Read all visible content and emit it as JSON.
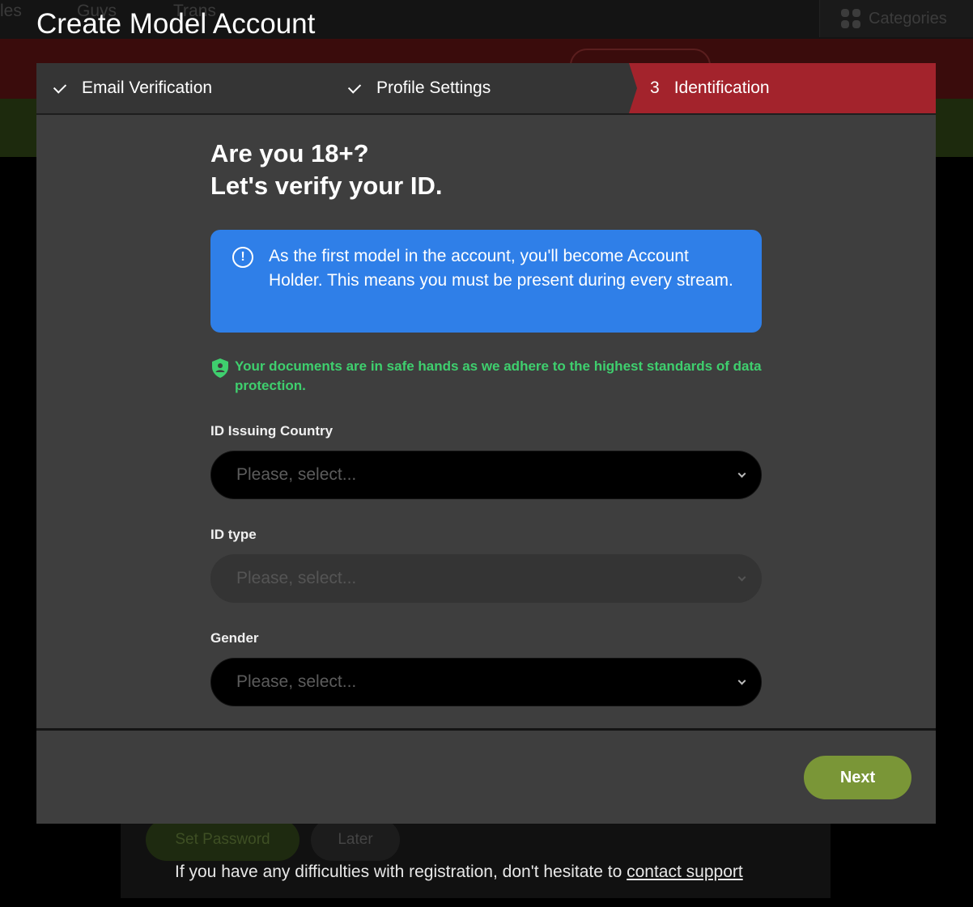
{
  "background": {
    "nav": [
      "les",
      "Guys",
      "Trans"
    ],
    "categories_label": "Categories",
    "page_title": "Create Model Account",
    "set_password_label": "Set Password",
    "later_label": "Later",
    "help_text": "If you have any difficulties with registration, don't hesitate to ",
    "help_link": "contact support"
  },
  "steps": [
    {
      "label": "Email Verification",
      "status": "done"
    },
    {
      "label": "Profile Settings",
      "status": "done"
    },
    {
      "number": "3",
      "label": "Identification",
      "status": "active"
    }
  ],
  "heading": {
    "line1": "Are you 18+?",
    "line2": "Let's verify your ID."
  },
  "info": "As the first model in the account, you'll become Account Holder. This means you must be present during every stream.",
  "safe_note": "Your documents are in safe hands as we adhere to the highest standards of data protection.",
  "fields": [
    {
      "label": "ID Issuing Country",
      "placeholder": "Please, select..."
    },
    {
      "label": "ID type",
      "placeholder": "Please, select...",
      "disabled": true
    },
    {
      "label": "Gender",
      "placeholder": "Please, select..."
    }
  ],
  "next_label": "Next",
  "colors": {
    "active_step": "#a3232c",
    "info_box": "#2f7fe8",
    "safe_text": "#3fcf6e",
    "next_button": "#7a9637"
  }
}
